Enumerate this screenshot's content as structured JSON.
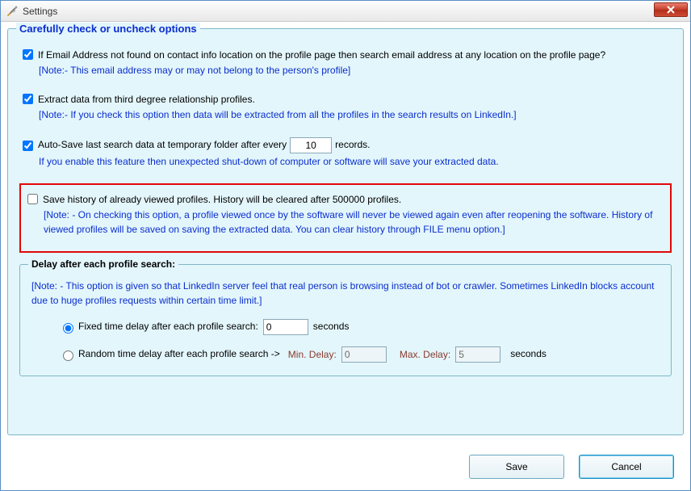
{
  "window": {
    "title": "Settings"
  },
  "group": {
    "legend": "Carefully check or uncheck options"
  },
  "opt_email": {
    "checked": true,
    "label": "If Email Address not found on contact info location on the profile page then search email address at any location on the profile page?",
    "note": "[Note:- This email address may or may not belong to the person's profile]"
  },
  "opt_third": {
    "checked": true,
    "label": "Extract data from third degree relationship profiles.",
    "note": "[Note:- If you check this option then data will be extracted from all the profiles in the search results on LinkedIn.]"
  },
  "opt_autosave": {
    "checked": true,
    "label_before": "Auto-Save last search data at temporary folder after every",
    "value": "10",
    "label_after": "records.",
    "note": "If you enable this feature then unexpected shut-down of computer or software will save your extracted data."
  },
  "opt_history": {
    "checked": false,
    "label": "Save history of already viewed profiles. History will be cleared after 500000 profiles.",
    "note": "[Note: - On checking this option, a profile viewed once by the software will never be viewed again even after reopening the software. History of viewed profiles will be saved on saving the extracted data. You can clear history through FILE menu option.]"
  },
  "delay": {
    "legend": "Delay after each profile search:",
    "note": "[Note: - This option is given so that LinkedIn server feel that real person is browsing instead of bot or crawler. Sometimes LinkedIn blocks account due to huge profiles requests within certain time limit.]",
    "fixed": {
      "selected": true,
      "label": "Fixed time delay after each profile search:",
      "value": "0",
      "unit": "seconds"
    },
    "random": {
      "selected": false,
      "label": "Random time delay after each profile search ->",
      "min_label": "Min. Delay:",
      "min_value": "0",
      "max_label": "Max. Delay:",
      "max_value": "5",
      "unit": "seconds"
    }
  },
  "buttons": {
    "save": "Save",
    "cancel": "Cancel"
  }
}
